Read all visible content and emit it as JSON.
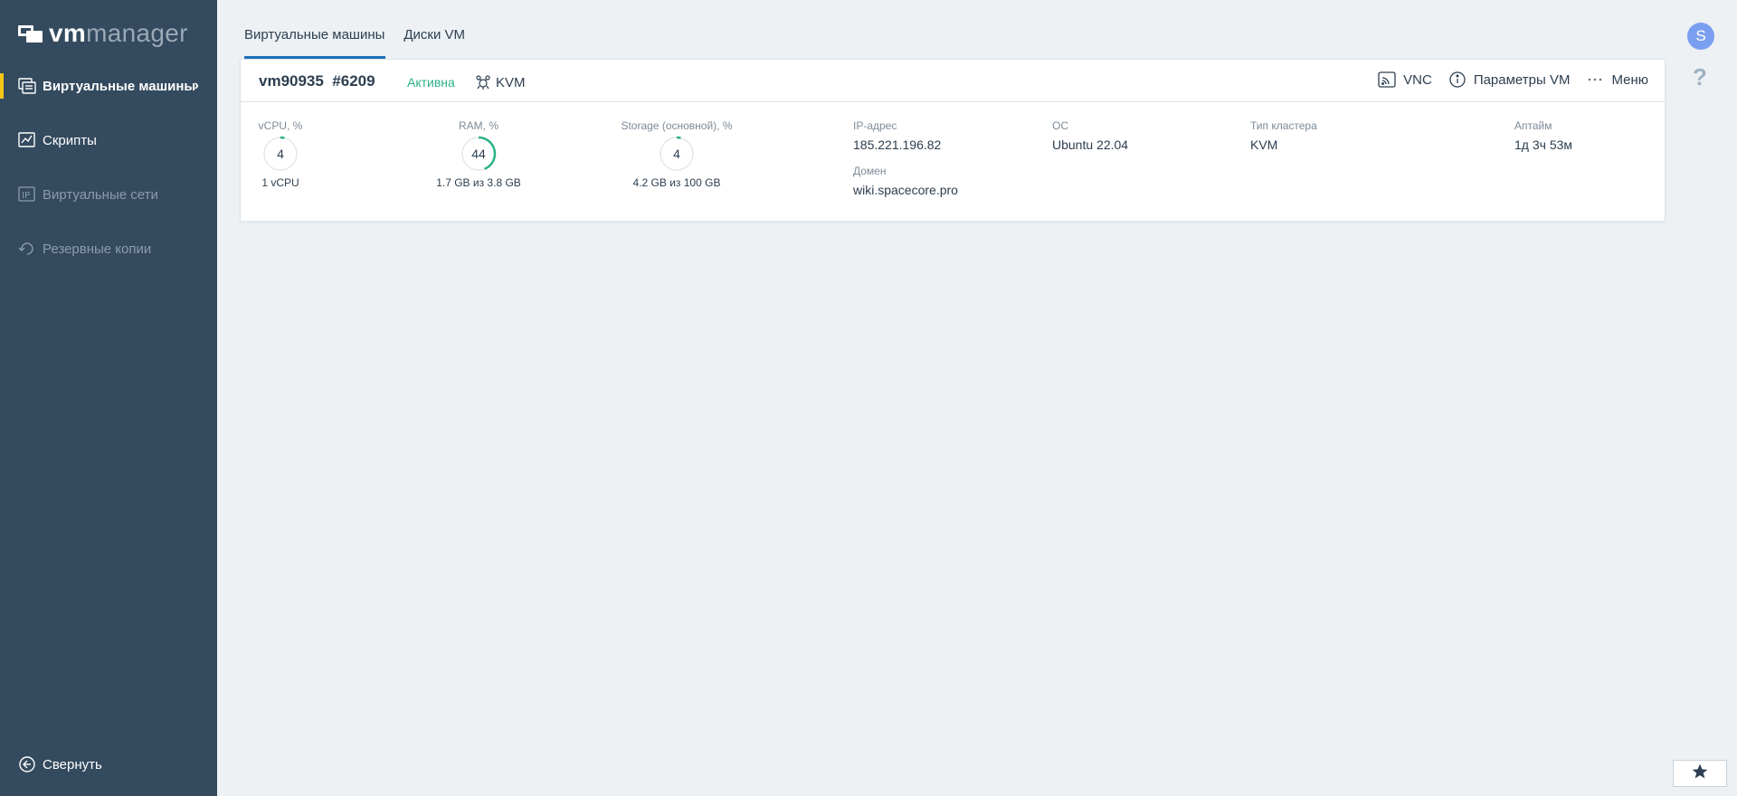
{
  "brand": {
    "vm": "vm",
    "manager": "manager"
  },
  "sidebar": {
    "items": [
      {
        "label": "Виртуальные машины",
        "icon": "vm-list-icon",
        "state": "active"
      },
      {
        "label": "Скрипты",
        "icon": "scripts-icon",
        "state": "normal"
      },
      {
        "label": "Виртуальные сети",
        "icon": "ip-network-icon",
        "state": "disabled"
      },
      {
        "label": "Резервные копии",
        "icon": "backup-icon",
        "state": "disabled"
      }
    ],
    "collapse_label": "Свернуть"
  },
  "tabs": [
    {
      "label": "Виртуальные машины",
      "active": true
    },
    {
      "label": "Диски VM",
      "active": false
    }
  ],
  "user": {
    "initial": "S"
  },
  "help": {
    "label": "?"
  },
  "vm": {
    "name": "vm90935",
    "id": "#6209",
    "status": "Активна",
    "virtualization": "KVM",
    "actions": {
      "vnc": "VNC",
      "params": "Параметры VM",
      "menu": "Меню"
    },
    "metrics": {
      "cpu": {
        "label": "vCPU, %",
        "value": "4",
        "percent": 4,
        "sub": "1 vCPU"
      },
      "ram": {
        "label": "RAM, %",
        "value": "44",
        "percent": 44,
        "sub": "1.7 GB из 3.8 GB"
      },
      "storage": {
        "label": "Storage (основной), %",
        "value": "4",
        "percent": 4,
        "sub": "4.2 GB из 100 GB"
      }
    },
    "info": {
      "ip_label": "IP-адрес",
      "ip": "185.221.196.82",
      "domain_label": "Домен",
      "domain": "wiki.spacecore.pro",
      "os_label": "ОС",
      "os": "Ubuntu 22.04",
      "cluster_label": "Тип кластера",
      "cluster": "KVM",
      "uptime_label": "Аптайм",
      "uptime": "1д 3ч 53м"
    }
  },
  "colors": {
    "sidebar_bg": "#344a5e",
    "accent_active": "#f5c518",
    "status_green": "#2bb189",
    "gauge_green": "#2bb189",
    "tab_underline": "#1f6fba",
    "avatar": "#7b9ff0"
  }
}
